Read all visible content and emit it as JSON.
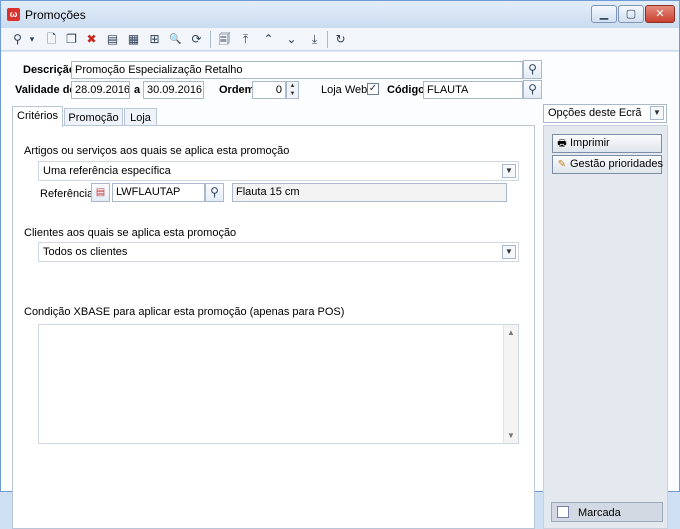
{
  "window": {
    "title": "Promoções",
    "app_icon_text": "ω",
    "minimize": "▁",
    "maximize": "▢",
    "close": "✕"
  },
  "toolbar": {
    "icons": [
      "search-icon",
      "dropdown-caret-icon",
      "new-document-icon",
      "copy-document-icon",
      "delete-icon",
      "notes-icon",
      "table-icon",
      "hierarchy-icon",
      "folder-search-icon",
      "refresh-icon",
      "print-preview-icon",
      "first-record-icon",
      "previous-record-icon",
      "next-record-icon",
      "last-record-icon",
      "undo-icon"
    ],
    "glyphs": {
      "search": "⚲",
      "caret": "▾",
      "new": "🗋",
      "copy": "❐",
      "delete": "✖",
      "notes": "▤",
      "table": "▦",
      "hierarchy": "⊞",
      "folder_search": "🔍",
      "refresh": "⟳",
      "preview": "🗐",
      "first": "⤒",
      "prev": "⌃",
      "next": "⌄",
      "last": "⤓",
      "undo": "↻"
    }
  },
  "header": {
    "descricao_label": "Descrição",
    "descricao_value": "Promoção Especialização Retalho",
    "validade_label": "Validade de",
    "validade_from": "28.09.2016",
    "a_label": "a",
    "validade_to": "30.09.2016",
    "ordem_label": "Ordem",
    "ordem_value": "0",
    "loja_web_label": "Loja Web",
    "loja_web_checked": "✓",
    "codigo_label": "Código",
    "codigo_value": "FLAUTA"
  },
  "tabs": [
    {
      "label": "Critérios"
    },
    {
      "label": "Promoção"
    },
    {
      "label": "Loja"
    }
  ],
  "criterios": {
    "artigos_label": "Artigos ou serviços aos quais se aplica esta promoção",
    "artigos_select": "Uma referência específica",
    "referencia_label": "Referência",
    "referencia_value": "LWFLAUTAP",
    "referencia_desc": "Flauta 15 cm",
    "clientes_label": "Clientes aos quais se aplica esta promoção",
    "clientes_select": "Todos os clientes",
    "condicao_label": "Condição XBASE para aplicar esta promoção (apenas para POS)",
    "condicao_value": ""
  },
  "right_panel": {
    "opcoes_select": "Opções deste Ecrã",
    "imprimir_label": "Imprimir",
    "gestao_label": "Gestão prioridades",
    "marcada_label": "Marcada"
  }
}
